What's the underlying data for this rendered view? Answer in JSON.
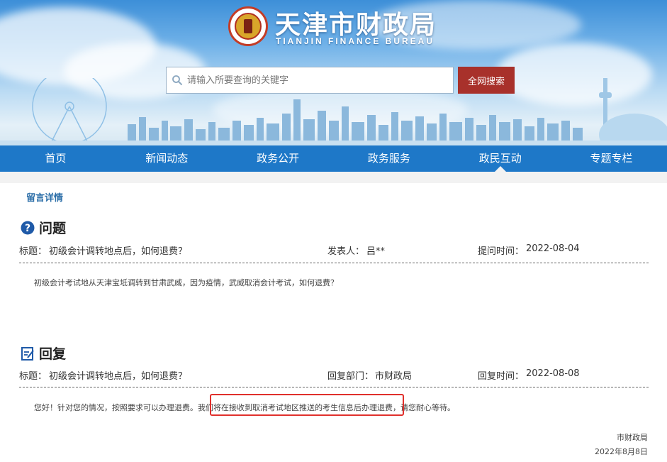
{
  "site": {
    "title": "天津市财政局",
    "subtitle": "TIANJIN FINANCE BUREAU"
  },
  "search": {
    "placeholder": "请输入所要查询的关键字",
    "button_label": "全网搜索"
  },
  "nav": {
    "items": [
      "首页",
      "新闻动态",
      "政务公开",
      "政务服务",
      "政民互动",
      "专题专栏"
    ],
    "active_index": 4
  },
  "breadcrumb": "留言详情",
  "question": {
    "heading": "问题",
    "title_label": "标题：",
    "title": "初级会计调转地点后，如何退费？",
    "poster_label": "发表人：",
    "poster": "吕**",
    "time_label": "提问时间：",
    "time": "2022-08-04",
    "body": "初级会计考试地从天津宝坻调转到甘肃武威，因为疫情，武威取消会计考试，如何退费？"
  },
  "reply": {
    "heading": "回复",
    "title_label": "标题：",
    "title": "初级会计调转地点后，如何退费？",
    "dept_label": "回复部门：",
    "dept": "市财政局",
    "time_label": "回复时间：",
    "time": "2022-08-08",
    "body": "您好！针对您的情况，按照要求可以办理退费。我们将在接收到取消考试地区推送的考生信息后办理退费，请您耐心等待。",
    "signature": "市财政局",
    "date": "2022年8月8日"
  },
  "colors": {
    "nav_blue": "#1e78c8",
    "search_button": "#a8312b",
    "highlight": "#e0302c",
    "link": "#2b6ea8"
  },
  "icons": {
    "question": "question-circle-icon",
    "reply": "edit-note-icon",
    "search": "magnifier-icon"
  }
}
